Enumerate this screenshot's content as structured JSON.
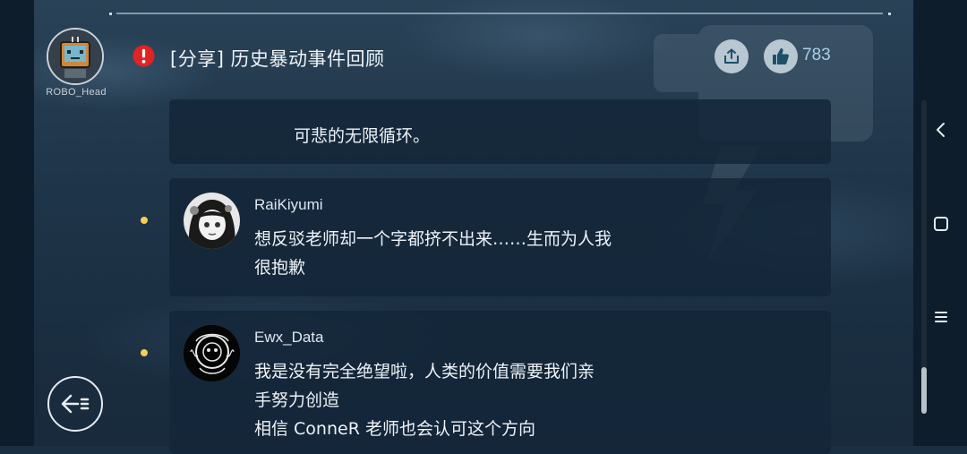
{
  "user": {
    "name": "ROBO_Head"
  },
  "header": {
    "title": "[分享] 历史暴动事件回顾",
    "like_count": "783",
    "icons": {
      "alert": "alert-icon",
      "share": "share-icon",
      "like": "thumbs-up-icon"
    }
  },
  "colors": {
    "accent": "#a9d0ea",
    "bullet": "#f3cf55",
    "alert": "#e02424"
  },
  "posts": [
    {
      "text": "可悲的无限循环。"
    },
    {
      "author": "RaiKiyumi",
      "text": "想反驳老师却一个字都挤不出来……生而为人我\n很抱歉"
    },
    {
      "author": "Ewx_Data",
      "text": "我是没有完全绝望啦，人类的价值需要我们亲\n手努力创造\n相信 ConneR 老师也会认可这个方向"
    }
  ],
  "nav": {
    "back": "chevron-left-icon",
    "home": "square-icon",
    "menu": "menu-icon",
    "exit": "exit-arrow-icon"
  }
}
